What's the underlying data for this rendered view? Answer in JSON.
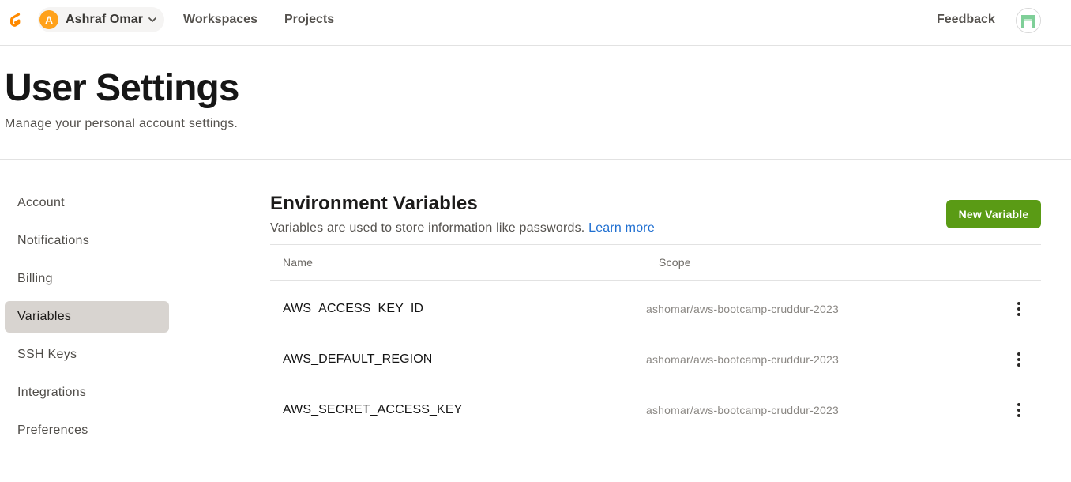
{
  "topbar": {
    "user": {
      "initial": "A",
      "name": "Ashraf Omar"
    },
    "nav": [
      "Workspaces",
      "Projects"
    ],
    "feedback": "Feedback"
  },
  "header": {
    "title": "User Settings",
    "subtitle": "Manage your personal account settings."
  },
  "sidebar": {
    "items": [
      {
        "label": "Account"
      },
      {
        "label": "Notifications"
      },
      {
        "label": "Billing"
      },
      {
        "label": "Variables",
        "active": true
      },
      {
        "label": "SSH Keys"
      },
      {
        "label": "Integrations"
      },
      {
        "label": "Preferences"
      }
    ]
  },
  "main": {
    "title": "Environment Variables",
    "description": "Variables are used to store information like passwords.",
    "learn_more": "Learn more",
    "new_button": "New Variable",
    "table": {
      "columns": [
        "Name",
        "Scope"
      ],
      "rows": [
        {
          "name": "AWS_ACCESS_KEY_ID",
          "scope": "ashomar/aws-bootcamp-cruddur-2023"
        },
        {
          "name": "AWS_DEFAULT_REGION",
          "scope": "ashomar/aws-bootcamp-cruddur-2023"
        },
        {
          "name": "AWS_SECRET_ACCESS_KEY",
          "scope": "ashomar/aws-bootcamp-cruddur-2023"
        }
      ]
    }
  },
  "colors": {
    "accent": "#5a9b15",
    "link": "#1f6fd1",
    "logo": "#ff8a00",
    "avatar": "#ffa11a",
    "active_nav": "#d8d4d0"
  },
  "icons": [
    "gitpod-logo-icon",
    "chevron-down-icon",
    "user-avatar-icon",
    "more-vertical-icon"
  ]
}
